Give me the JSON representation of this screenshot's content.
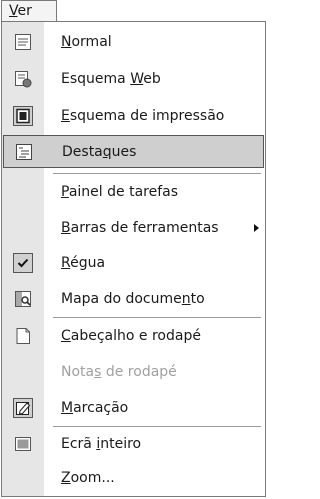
{
  "menu_title": {
    "text": "Ver",
    "mnemonic": "V",
    "rest": "er"
  },
  "items": [
    {
      "label": "Normal",
      "pre": "",
      "u": "N",
      "post": "ormal",
      "icon": "normal-view-icon"
    },
    {
      "label": "Esquema Web",
      "pre": "Esquema ",
      "u": "W",
      "post": "eb",
      "icon": "web-layout-icon"
    },
    {
      "label": "Esquema de impressão",
      "pre": "",
      "u": "E",
      "post": "squema de impressão",
      "icon": "print-layout-icon"
    },
    {
      "label": "Destaques",
      "pre": "Desta",
      "u": "q",
      "post": "ues",
      "icon": "outline-view-icon"
    },
    {
      "label": "Painel de tarefas",
      "pre": "",
      "u": "P",
      "post": "ainel de tarefas",
      "icon": ""
    },
    {
      "label": "Barras de ferramentas",
      "pre": "",
      "u": "B",
      "post": "arras de ferramentas",
      "icon": "",
      "submenu": true
    },
    {
      "label": "Régua",
      "pre": "",
      "u": "R",
      "post": "égua",
      "icon": "checkmark-icon",
      "checked": true
    },
    {
      "label": "Mapa do documento",
      "pre": "Mapa do docume",
      "u": "n",
      "post": "to",
      "icon": "document-map-icon"
    },
    {
      "label": "Cabeçalho e rodapé",
      "pre": "",
      "u": "C",
      "post": "abeçalho e rodapé",
      "icon": "header-footer-icon"
    },
    {
      "label": "Notas de rodapé",
      "pre": "Nota",
      "u": "s",
      "post": " de rodapé",
      "icon": "",
      "disabled": true
    },
    {
      "label": "Marcação",
      "pre": "",
      "u": "M",
      "post": "arcação",
      "icon": "markup-icon"
    },
    {
      "label": "Ecrã inteiro",
      "pre": "Ecrã ",
      "u": "i",
      "post": "nteiro",
      "icon": "full-screen-icon"
    },
    {
      "label": "Zoom...",
      "pre": "",
      "u": "Z",
      "post": "oom...",
      "icon": ""
    }
  ],
  "highlighted_item": "Destaques",
  "colors": {
    "gutter": "#e6e6e6",
    "highlight": "#cfcfcf",
    "disabled_text": "#a0a0a0"
  }
}
